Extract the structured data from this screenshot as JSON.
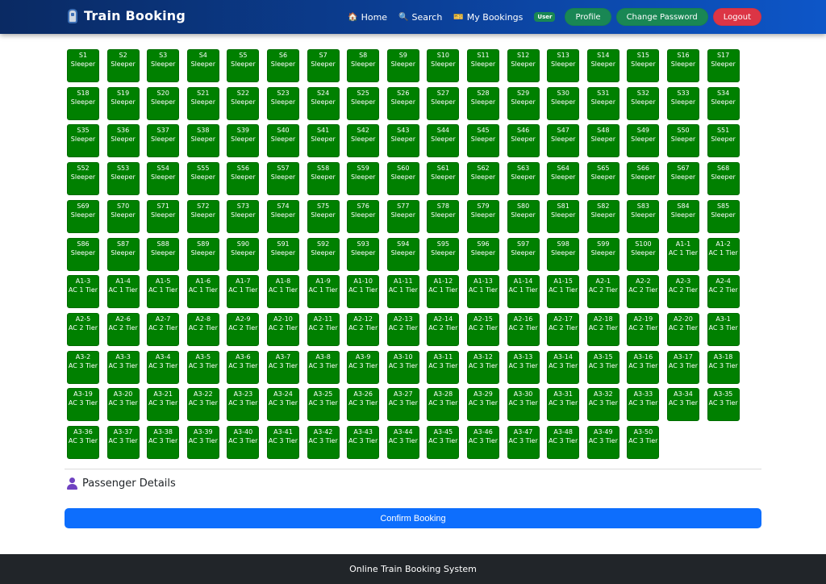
{
  "navbar": {
    "brand": "Train Booking",
    "links": [
      {
        "icon": "house-icon",
        "glyph": "🏠",
        "label": "Home"
      },
      {
        "icon": "search-icon",
        "glyph": "🔍",
        "label": "Search"
      },
      {
        "icon": "ticket-icon",
        "glyph": "🎫",
        "label": "My Bookings"
      }
    ],
    "role": "User",
    "profile": "Profile",
    "change_password": "Change Password",
    "logout": "Logout"
  },
  "seats": [
    {
      "n": "S1",
      "c": "Sleeper"
    },
    {
      "n": "S2",
      "c": "Sleeper"
    },
    {
      "n": "S3",
      "c": "Sleeper"
    },
    {
      "n": "S4",
      "c": "Sleeper"
    },
    {
      "n": "S5",
      "c": "Sleeper"
    },
    {
      "n": "S6",
      "c": "Sleeper"
    },
    {
      "n": "S7",
      "c": "Sleeper"
    },
    {
      "n": "S8",
      "c": "Sleeper"
    },
    {
      "n": "S9",
      "c": "Sleeper"
    },
    {
      "n": "S10",
      "c": "Sleeper"
    },
    {
      "n": "S11",
      "c": "Sleeper"
    },
    {
      "n": "S12",
      "c": "Sleeper"
    },
    {
      "n": "S13",
      "c": "Sleeper"
    },
    {
      "n": "S14",
      "c": "Sleeper"
    },
    {
      "n": "S15",
      "c": "Sleeper"
    },
    {
      "n": "S16",
      "c": "Sleeper"
    },
    {
      "n": "S17",
      "c": "Sleeper"
    },
    {
      "n": "S18",
      "c": "Sleeper"
    },
    {
      "n": "S19",
      "c": "Sleeper"
    },
    {
      "n": "S20",
      "c": "Sleeper"
    },
    {
      "n": "S21",
      "c": "Sleeper"
    },
    {
      "n": "S22",
      "c": "Sleeper"
    },
    {
      "n": "S23",
      "c": "Sleeper"
    },
    {
      "n": "S24",
      "c": "Sleeper"
    },
    {
      "n": "S25",
      "c": "Sleeper"
    },
    {
      "n": "S26",
      "c": "Sleeper"
    },
    {
      "n": "S27",
      "c": "Sleeper"
    },
    {
      "n": "S28",
      "c": "Sleeper"
    },
    {
      "n": "S29",
      "c": "Sleeper"
    },
    {
      "n": "S30",
      "c": "Sleeper"
    },
    {
      "n": "S31",
      "c": "Sleeper"
    },
    {
      "n": "S32",
      "c": "Sleeper"
    },
    {
      "n": "S33",
      "c": "Sleeper"
    },
    {
      "n": "S34",
      "c": "Sleeper"
    },
    {
      "n": "S35",
      "c": "Sleeper"
    },
    {
      "n": "S36",
      "c": "Sleeper"
    },
    {
      "n": "S37",
      "c": "Sleeper"
    },
    {
      "n": "S38",
      "c": "Sleeper"
    },
    {
      "n": "S39",
      "c": "Sleeper"
    },
    {
      "n": "S40",
      "c": "Sleeper"
    },
    {
      "n": "S41",
      "c": "Sleeper"
    },
    {
      "n": "S42",
      "c": "Sleeper"
    },
    {
      "n": "S43",
      "c": "Sleeper"
    },
    {
      "n": "S44",
      "c": "Sleeper"
    },
    {
      "n": "S45",
      "c": "Sleeper"
    },
    {
      "n": "S46",
      "c": "Sleeper"
    },
    {
      "n": "S47",
      "c": "Sleeper"
    },
    {
      "n": "S48",
      "c": "Sleeper"
    },
    {
      "n": "S49",
      "c": "Sleeper"
    },
    {
      "n": "S50",
      "c": "Sleeper"
    },
    {
      "n": "S51",
      "c": "Sleeper"
    },
    {
      "n": "S52",
      "c": "Sleeper"
    },
    {
      "n": "S53",
      "c": "Sleeper"
    },
    {
      "n": "S54",
      "c": "Sleeper"
    },
    {
      "n": "S55",
      "c": "Sleeper"
    },
    {
      "n": "S56",
      "c": "Sleeper"
    },
    {
      "n": "S57",
      "c": "Sleeper"
    },
    {
      "n": "S58",
      "c": "Sleeper"
    },
    {
      "n": "S59",
      "c": "Sleeper"
    },
    {
      "n": "S60",
      "c": "Sleeper"
    },
    {
      "n": "S61",
      "c": "Sleeper"
    },
    {
      "n": "S62",
      "c": "Sleeper"
    },
    {
      "n": "S63",
      "c": "Sleeper"
    },
    {
      "n": "S64",
      "c": "Sleeper"
    },
    {
      "n": "S65",
      "c": "Sleeper"
    },
    {
      "n": "S66",
      "c": "Sleeper"
    },
    {
      "n": "S67",
      "c": "Sleeper"
    },
    {
      "n": "S68",
      "c": "Sleeper"
    },
    {
      "n": "S69",
      "c": "Sleeper"
    },
    {
      "n": "S70",
      "c": "Sleeper"
    },
    {
      "n": "S71",
      "c": "Sleeper"
    },
    {
      "n": "S72",
      "c": "Sleeper"
    },
    {
      "n": "S73",
      "c": "Sleeper"
    },
    {
      "n": "S74",
      "c": "Sleeper"
    },
    {
      "n": "S75",
      "c": "Sleeper"
    },
    {
      "n": "S76",
      "c": "Sleeper"
    },
    {
      "n": "S77",
      "c": "Sleeper"
    },
    {
      "n": "S78",
      "c": "Sleeper"
    },
    {
      "n": "S79",
      "c": "Sleeper"
    },
    {
      "n": "S80",
      "c": "Sleeper"
    },
    {
      "n": "S81",
      "c": "Sleeper"
    },
    {
      "n": "S82",
      "c": "Sleeper"
    },
    {
      "n": "S83",
      "c": "Sleeper"
    },
    {
      "n": "S84",
      "c": "Sleeper"
    },
    {
      "n": "S85",
      "c": "Sleeper"
    },
    {
      "n": "S86",
      "c": "Sleeper"
    },
    {
      "n": "S87",
      "c": "Sleeper"
    },
    {
      "n": "S88",
      "c": "Sleeper"
    },
    {
      "n": "S89",
      "c": "Sleeper"
    },
    {
      "n": "S90",
      "c": "Sleeper"
    },
    {
      "n": "S91",
      "c": "Sleeper"
    },
    {
      "n": "S92",
      "c": "Sleeper"
    },
    {
      "n": "S93",
      "c": "Sleeper"
    },
    {
      "n": "S94",
      "c": "Sleeper"
    },
    {
      "n": "S95",
      "c": "Sleeper"
    },
    {
      "n": "S96",
      "c": "Sleeper"
    },
    {
      "n": "S97",
      "c": "Sleeper"
    },
    {
      "n": "S98",
      "c": "Sleeper"
    },
    {
      "n": "S99",
      "c": "Sleeper"
    },
    {
      "n": "S100",
      "c": "Sleeper"
    },
    {
      "n": "A1-1",
      "c": "AC 1 Tier"
    },
    {
      "n": "A1-2",
      "c": "AC 1 Tier"
    },
    {
      "n": "A1-3",
      "c": "AC 1 Tier"
    },
    {
      "n": "A1-4",
      "c": "AC 1 Tier"
    },
    {
      "n": "A1-5",
      "c": "AC 1 Tier"
    },
    {
      "n": "A1-6",
      "c": "AC 1 Tier"
    },
    {
      "n": "A1-7",
      "c": "AC 1 Tier"
    },
    {
      "n": "A1-8",
      "c": "AC 1 Tier"
    },
    {
      "n": "A1-9",
      "c": "AC 1 Tier"
    },
    {
      "n": "A1-10",
      "c": "AC 1 Tier"
    },
    {
      "n": "A1-11",
      "c": "AC 1 Tier"
    },
    {
      "n": "A1-12",
      "c": "AC 1 Tier"
    },
    {
      "n": "A1-13",
      "c": "AC 1 Tier"
    },
    {
      "n": "A1-14",
      "c": "AC 1 Tier"
    },
    {
      "n": "A1-15",
      "c": "AC 1 Tier"
    },
    {
      "n": "A2-1",
      "c": "AC 2 Tier"
    },
    {
      "n": "A2-2",
      "c": "AC 2 Tier"
    },
    {
      "n": "A2-3",
      "c": "AC 2 Tier"
    },
    {
      "n": "A2-4",
      "c": "AC 2 Tier"
    },
    {
      "n": "A2-5",
      "c": "AC 2 Tier"
    },
    {
      "n": "A2-6",
      "c": "AC 2 Tier"
    },
    {
      "n": "A2-7",
      "c": "AC 2 Tier"
    },
    {
      "n": "A2-8",
      "c": "AC 2 Tier"
    },
    {
      "n": "A2-9",
      "c": "AC 2 Tier"
    },
    {
      "n": "A2-10",
      "c": "AC 2 Tier"
    },
    {
      "n": "A2-11",
      "c": "AC 2 Tier"
    },
    {
      "n": "A2-12",
      "c": "AC 2 Tier"
    },
    {
      "n": "A2-13",
      "c": "AC 2 Tier"
    },
    {
      "n": "A2-14",
      "c": "AC 2 Tier"
    },
    {
      "n": "A2-15",
      "c": "AC 2 Tier"
    },
    {
      "n": "A2-16",
      "c": "AC 2 Tier"
    },
    {
      "n": "A2-17",
      "c": "AC 2 Tier"
    },
    {
      "n": "A2-18",
      "c": "AC 2 Tier"
    },
    {
      "n": "A2-19",
      "c": "AC 2 Tier"
    },
    {
      "n": "A2-20",
      "c": "AC 2 Tier"
    },
    {
      "n": "A3-1",
      "c": "AC 3 Tier"
    },
    {
      "n": "A3-2",
      "c": "AC 3 Tier"
    },
    {
      "n": "A3-3",
      "c": "AC 3 Tier"
    },
    {
      "n": "A3-4",
      "c": "AC 3 Tier"
    },
    {
      "n": "A3-5",
      "c": "AC 3 Tier"
    },
    {
      "n": "A3-6",
      "c": "AC 3 Tier"
    },
    {
      "n": "A3-7",
      "c": "AC 3 Tier"
    },
    {
      "n": "A3-8",
      "c": "AC 3 Tier"
    },
    {
      "n": "A3-9",
      "c": "AC 3 Tier"
    },
    {
      "n": "A3-10",
      "c": "AC 3 Tier"
    },
    {
      "n": "A3-11",
      "c": "AC 3 Tier"
    },
    {
      "n": "A3-12",
      "c": "AC 3 Tier"
    },
    {
      "n": "A3-13",
      "c": "AC 3 Tier"
    },
    {
      "n": "A3-14",
      "c": "AC 3 Tier"
    },
    {
      "n": "A3-15",
      "c": "AC 3 Tier"
    },
    {
      "n": "A3-16",
      "c": "AC 3 Tier"
    },
    {
      "n": "A3-17",
      "c": "AC 3 Tier"
    },
    {
      "n": "A3-18",
      "c": "AC 3 Tier"
    },
    {
      "n": "A3-19",
      "c": "AC 3 Tier"
    },
    {
      "n": "A3-20",
      "c": "AC 3 Tier"
    },
    {
      "n": "A3-21",
      "c": "AC 3 Tier"
    },
    {
      "n": "A3-22",
      "c": "AC 3 Tier"
    },
    {
      "n": "A3-23",
      "c": "AC 3 Tier"
    },
    {
      "n": "A3-24",
      "c": "AC 3 Tier"
    },
    {
      "n": "A3-25",
      "c": "AC 3 Tier"
    },
    {
      "n": "A3-26",
      "c": "AC 3 Tier"
    },
    {
      "n": "A3-27",
      "c": "AC 3 Tier"
    },
    {
      "n": "A3-28",
      "c": "AC 3 Tier"
    },
    {
      "n": "A3-29",
      "c": "AC 3 Tier"
    },
    {
      "n": "A3-30",
      "c": "AC 3 Tier"
    },
    {
      "n": "A3-31",
      "c": "AC 3 Tier"
    },
    {
      "n": "A3-32",
      "c": "AC 3 Tier"
    },
    {
      "n": "A3-33",
      "c": "AC 3 Tier"
    },
    {
      "n": "A3-34",
      "c": "AC 3 Tier"
    },
    {
      "n": "A3-35",
      "c": "AC 3 Tier"
    },
    {
      "n": "A3-36",
      "c": "AC 3 Tier"
    },
    {
      "n": "A3-37",
      "c": "AC 3 Tier"
    },
    {
      "n": "A3-38",
      "c": "AC 3 Tier"
    },
    {
      "n": "A3-39",
      "c": "AC 3 Tier"
    },
    {
      "n": "A3-40",
      "c": "AC 3 Tier"
    },
    {
      "n": "A3-41",
      "c": "AC 3 Tier"
    },
    {
      "n": "A3-42",
      "c": "AC 3 Tier"
    },
    {
      "n": "A3-43",
      "c": "AC 3 Tier"
    },
    {
      "n": "A3-44",
      "c": "AC 3 Tier"
    },
    {
      "n": "A3-45",
      "c": "AC 3 Tier"
    },
    {
      "n": "A3-46",
      "c": "AC 3 Tier"
    },
    {
      "n": "A3-47",
      "c": "AC 3 Tier"
    },
    {
      "n": "A3-48",
      "c": "AC 3 Tier"
    },
    {
      "n": "A3-49",
      "c": "AC 3 Tier"
    },
    {
      "n": "A3-50",
      "c": "AC 3 Tier"
    }
  ],
  "passenger_section": {
    "icon": "person-icon",
    "title": "Passenger Details"
  },
  "confirm_button": "Confirm Booking",
  "footer": "Online Train Booking System",
  "colors": {
    "seat_available": "#008000",
    "primary": "#0d6efd",
    "success": "#198754",
    "danger": "#dc3545"
  }
}
